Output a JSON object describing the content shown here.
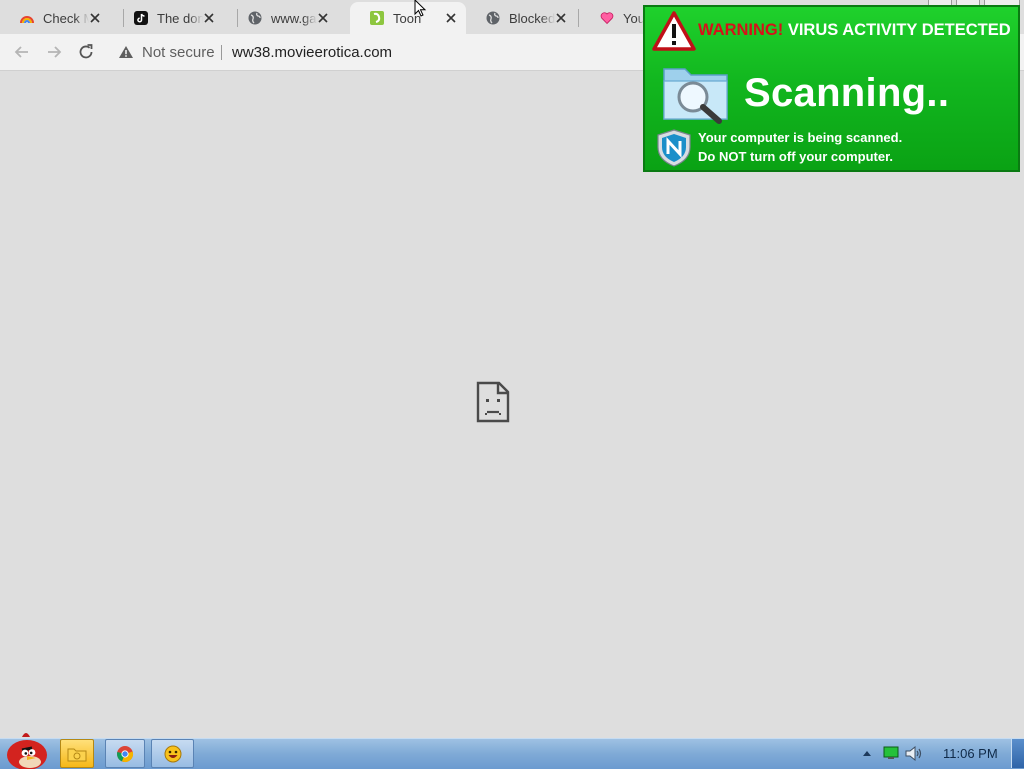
{
  "browser": {
    "tabs": [
      {
        "title": "Check M",
        "icon": "rainbow-favicon"
      },
      {
        "title": "The dom",
        "icon": "tiktok-favicon"
      },
      {
        "title": "www.gay",
        "icon": "globe-favicon"
      },
      {
        "title": "Toon",
        "icon": "toon-favicon",
        "active": true
      },
      {
        "title": "Blocked",
        "icon": "globe-favicon"
      },
      {
        "title": "Youn",
        "icon": "heart-favicon"
      }
    ],
    "security_label": "Not secure",
    "url": "ww38.movieerotica.com"
  },
  "page": {
    "state": "sad-page-icon"
  },
  "popup": {
    "warning_word": "WARNING!",
    "warning_rest": "VIRUS ACTIVITY DETECTED",
    "status": "Scanning..",
    "message_line1": "Your computer is being scanned.",
    "message_line2_pre": "Do",
    "message_line2_bold": "NOT",
    "message_line2_post": "turn off your computer.",
    "colors": {
      "background": "#12b71f",
      "warning_red": "#d6121a"
    }
  },
  "taskbar": {
    "clock": "11:06 PM"
  }
}
